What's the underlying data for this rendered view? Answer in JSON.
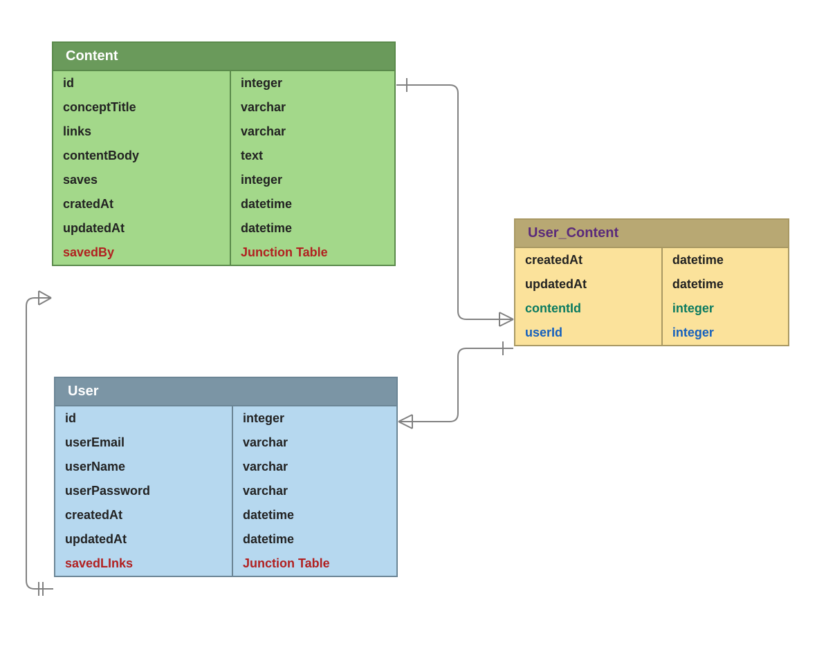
{
  "entities": {
    "content": {
      "title": "Content",
      "rows": [
        {
          "name": "id",
          "type": "integer",
          "style": ""
        },
        {
          "name": "conceptTitle",
          "type": "varchar",
          "style": ""
        },
        {
          "name": "links",
          "type": "varchar",
          "style": ""
        },
        {
          "name": "contentBody",
          "type": "text",
          "style": ""
        },
        {
          "name": "saves",
          "type": "integer",
          "style": ""
        },
        {
          "name": "cratedAt",
          "type": "datetime",
          "style": ""
        },
        {
          "name": "updatedAt",
          "type": "datetime",
          "style": ""
        },
        {
          "name": "savedBy",
          "type": "Junction Table",
          "style": "red"
        }
      ]
    },
    "user": {
      "title": "User",
      "rows": [
        {
          "name": "id",
          "type": "integer",
          "style": ""
        },
        {
          "name": "userEmail",
          "type": "varchar",
          "style": ""
        },
        {
          "name": "userName",
          "type": "varchar",
          "style": ""
        },
        {
          "name": "userPassword",
          "type": "varchar",
          "style": ""
        },
        {
          "name": "createdAt",
          "type": "datetime",
          "style": ""
        },
        {
          "name": "updatedAt",
          "type": "datetime",
          "style": ""
        },
        {
          "name": "savedLInks",
          "type": "Junction Table",
          "style": "red"
        }
      ]
    },
    "user_content": {
      "title": "User_Content",
      "rows": [
        {
          "name": "createdAt",
          "type": "datetime",
          "style": ""
        },
        {
          "name": "updatedAt",
          "type": "datetime",
          "style": ""
        },
        {
          "name": "contentId",
          "type": "integer",
          "style": "teal"
        },
        {
          "name": "userId",
          "type": "integer",
          "style": "blue"
        }
      ]
    }
  },
  "relationships": [
    {
      "from": "Content.id",
      "to": "User_Content.contentId",
      "cardinality": "one-to-many"
    },
    {
      "from": "User.id",
      "to": "User_Content.userId",
      "cardinality": "one-to-many"
    },
    {
      "from": "User.savedLInks",
      "to": "Content.savedBy",
      "cardinality": "one-to-many"
    }
  ]
}
